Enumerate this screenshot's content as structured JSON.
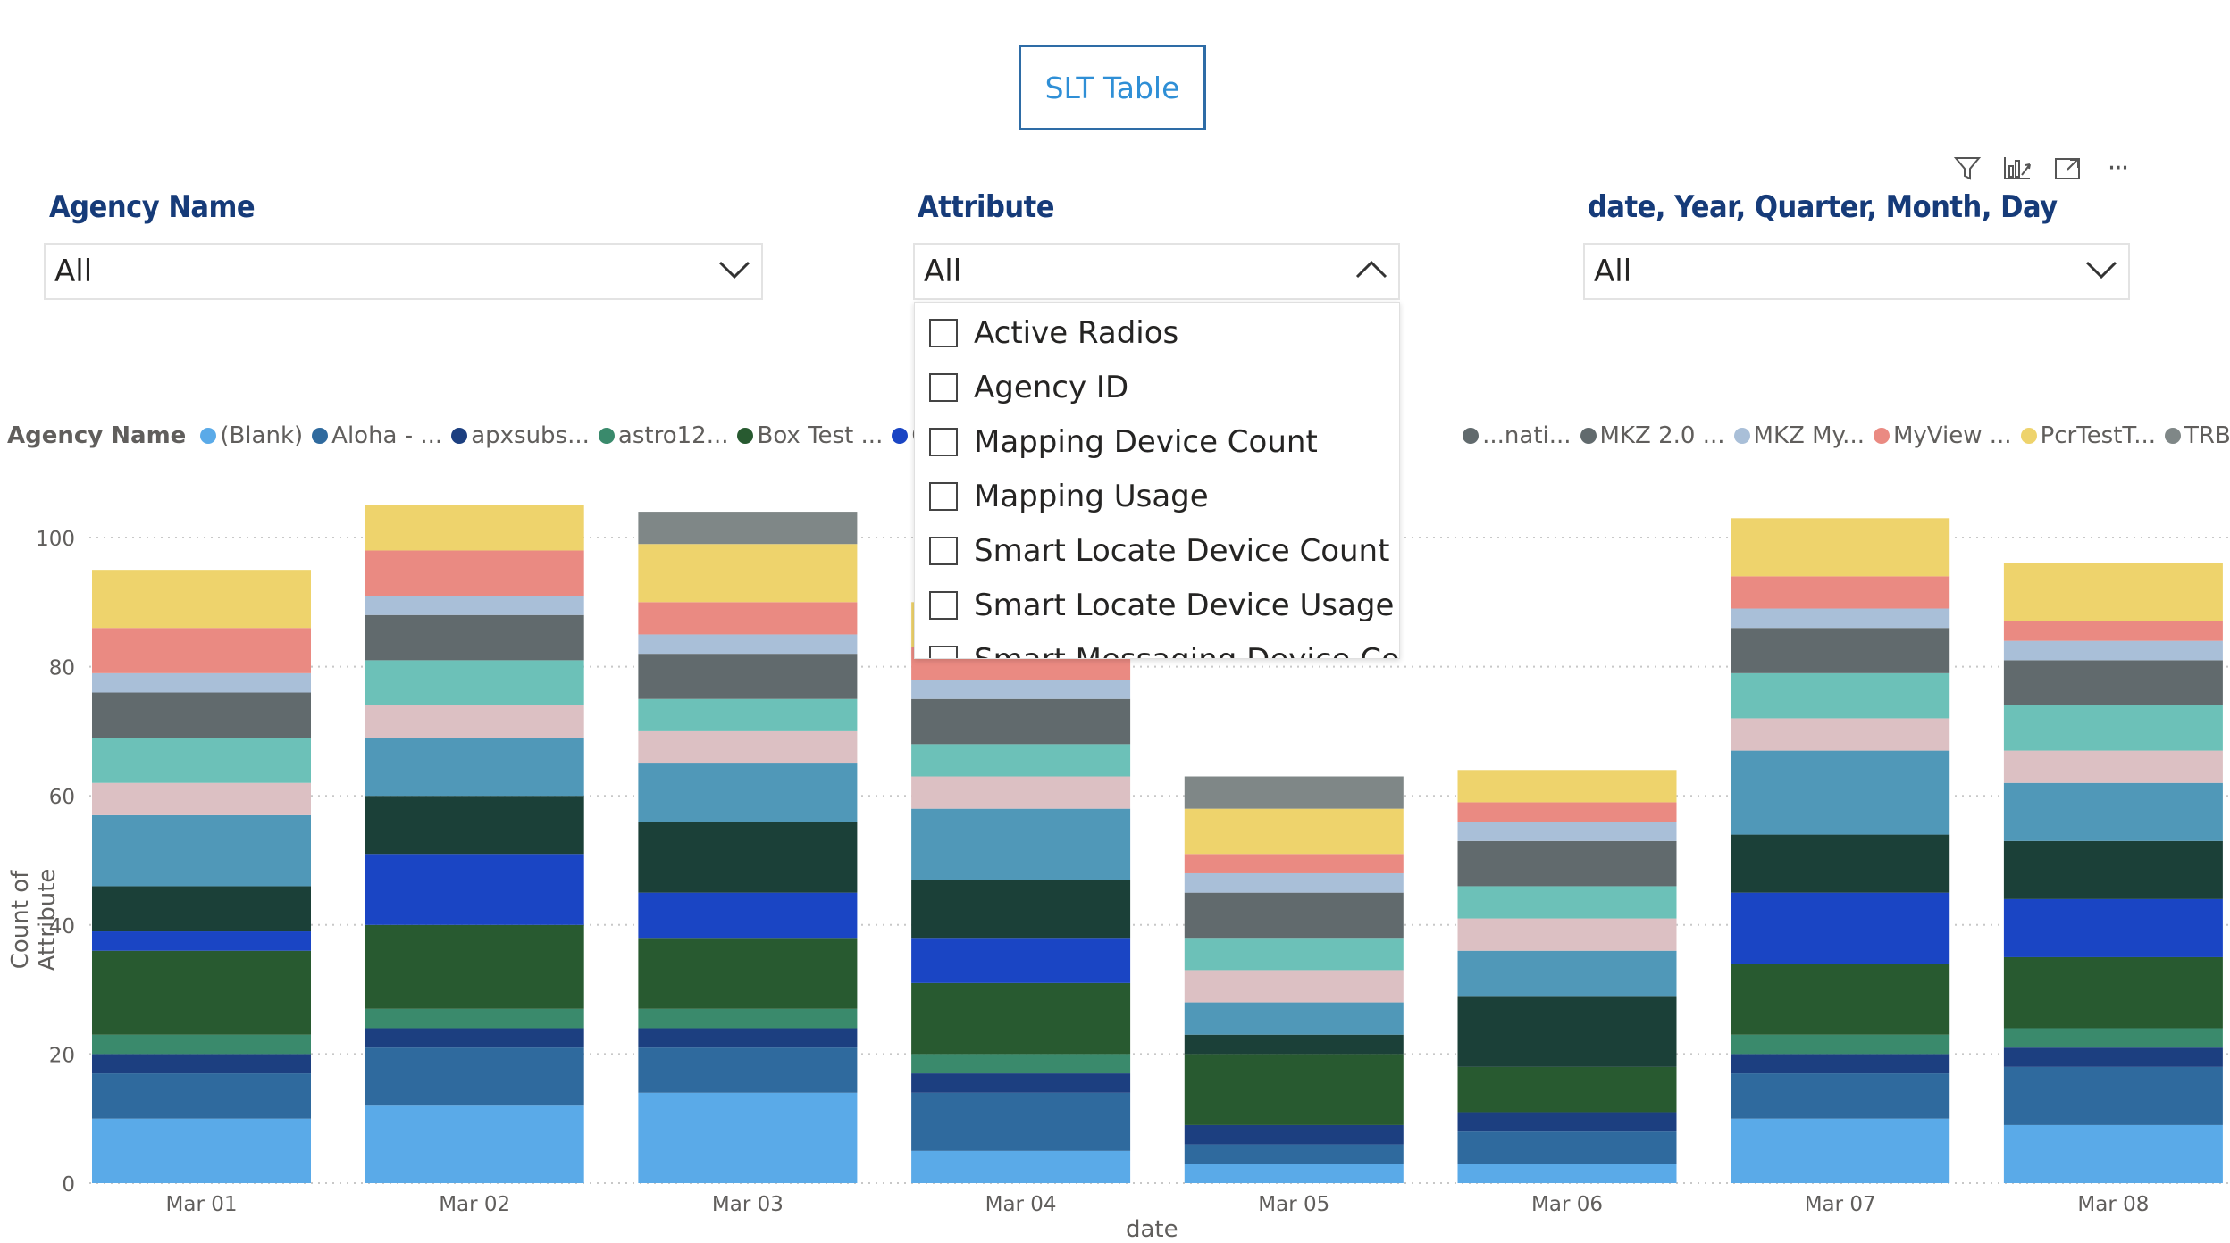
{
  "button": {
    "label": "SLT Table"
  },
  "toolbar": {
    "icons": [
      "filter-icon",
      "focus-chart-icon",
      "expand-icon",
      "more-options-icon"
    ],
    "more_label": "···"
  },
  "slicers": [
    {
      "title": "Agency Name",
      "value": "All",
      "expanded": false
    },
    {
      "title": "Attribute",
      "value": "All",
      "expanded": true
    },
    {
      "title": "date, Year, Quarter, Month, Day",
      "value": "All",
      "expanded": false
    }
  ],
  "attribute_options": [
    "Active Radios",
    "Agency ID",
    "Mapping Device Count",
    "Mapping Usage",
    "Smart Locate Device Count",
    "Smart Locate Device Usage",
    "Smart Messaging Device Count"
  ],
  "legend": {
    "title": "Agency Name",
    "items_before": [
      {
        "label": "(Blank)",
        "color": "#5aaae8"
      },
      {
        "label": "Aloha - ...",
        "color": "#2f6a9e"
      },
      {
        "label": "apxsubs...",
        "color": "#1c3f80"
      },
      {
        "label": "astro12...",
        "color": "#3a8a6c"
      },
      {
        "label": "Box Test ...",
        "color": "#285a30"
      },
      {
        "label": "Cloud N...",
        "color": "#1a45c4"
      }
    ],
    "items_after": [
      {
        "label": "...nati...",
        "color": "#616a6d"
      },
      {
        "label": "MKZ 2.0 ...",
        "color": "#616a6d"
      },
      {
        "label": "MKZ My...",
        "color": "#a9bfd8"
      },
      {
        "label": "MyView ...",
        "color": "#ea8a82"
      },
      {
        "label": "PcrTestT...",
        "color": "#eed36c"
      },
      {
        "label": "TRBONe...",
        "color": "#7f8787"
      }
    ]
  },
  "chart_data": {
    "type": "bar",
    "stacked": true,
    "xlabel": "date",
    "ylabel": "Count of Attribute",
    "ylim": [
      0,
      100
    ],
    "yticks": [
      0,
      20,
      40,
      60,
      80,
      100
    ],
    "grid": true,
    "categories": [
      "Mar 01",
      "Mar 02",
      "Mar 03",
      "Mar 04",
      "Mar 05",
      "Mar 06",
      "Mar 07",
      "Mar 08"
    ],
    "series_colors": [
      "#5aaae8",
      "#2f6a9e",
      "#1c3f80",
      "#3a8a6c",
      "#285a30",
      "#1a45c4",
      "#1b4038",
      "#5098b8",
      "#dcc0c3",
      "#6cc1b8",
      "#616a6d",
      "#a9bfd8",
      "#ea8a82",
      "#eed36c",
      "#7f8787"
    ],
    "series": [
      {
        "values": [
          10,
          12,
          14,
          5,
          3,
          3,
          10,
          9
        ]
      },
      {
        "values": [
          7,
          9,
          7,
          9,
          3,
          5,
          7,
          9
        ]
      },
      {
        "values": [
          3,
          3,
          3,
          3,
          3,
          3,
          3,
          3
        ]
      },
      {
        "values": [
          3,
          3,
          3,
          3,
          0,
          0,
          3,
          3
        ]
      },
      {
        "values": [
          13,
          13,
          11,
          11,
          11,
          7,
          11,
          11
        ]
      },
      {
        "values": [
          3,
          11,
          7,
          7,
          0,
          0,
          11,
          9
        ]
      },
      {
        "values": [
          7,
          9,
          11,
          9,
          3,
          11,
          9,
          9
        ]
      },
      {
        "values": [
          11,
          9,
          9,
          11,
          5,
          7,
          13,
          9
        ]
      },
      {
        "values": [
          5,
          5,
          5,
          5,
          5,
          5,
          5,
          5
        ]
      },
      {
        "values": [
          7,
          7,
          5,
          5,
          5,
          5,
          7,
          7
        ]
      },
      {
        "values": [
          7,
          7,
          7,
          7,
          7,
          7,
          7,
          7
        ]
      },
      {
        "values": [
          3,
          3,
          3,
          3,
          3,
          3,
          3,
          3
        ]
      },
      {
        "values": [
          7,
          7,
          5,
          5,
          3,
          3,
          5,
          3
        ]
      },
      {
        "values": [
          9,
          7,
          9,
          7,
          7,
          5,
          9,
          9
        ]
      },
      {
        "values": [
          0,
          0,
          5,
          0,
          5,
          0,
          0,
          0
        ]
      }
    ]
  }
}
